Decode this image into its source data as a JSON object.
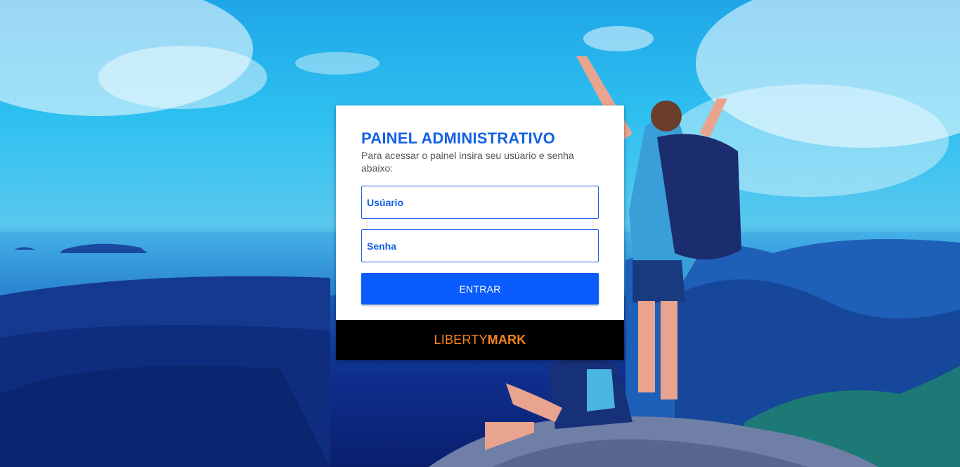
{
  "login": {
    "title": "PAINEL ADMINISTRATIVO",
    "subtitle": "Para acessar o painel insira seu usúario e senha abaixo:",
    "username_placeholder": "Usúario",
    "password_placeholder": "Senha",
    "submit_label": "ENTRAR"
  },
  "brand": {
    "part1": "LIBERTY",
    "part2": "MARK",
    "color": "#f58220"
  },
  "colors": {
    "accent": "#1461e6",
    "button": "#0b5cff",
    "footer_bg": "#000000"
  }
}
